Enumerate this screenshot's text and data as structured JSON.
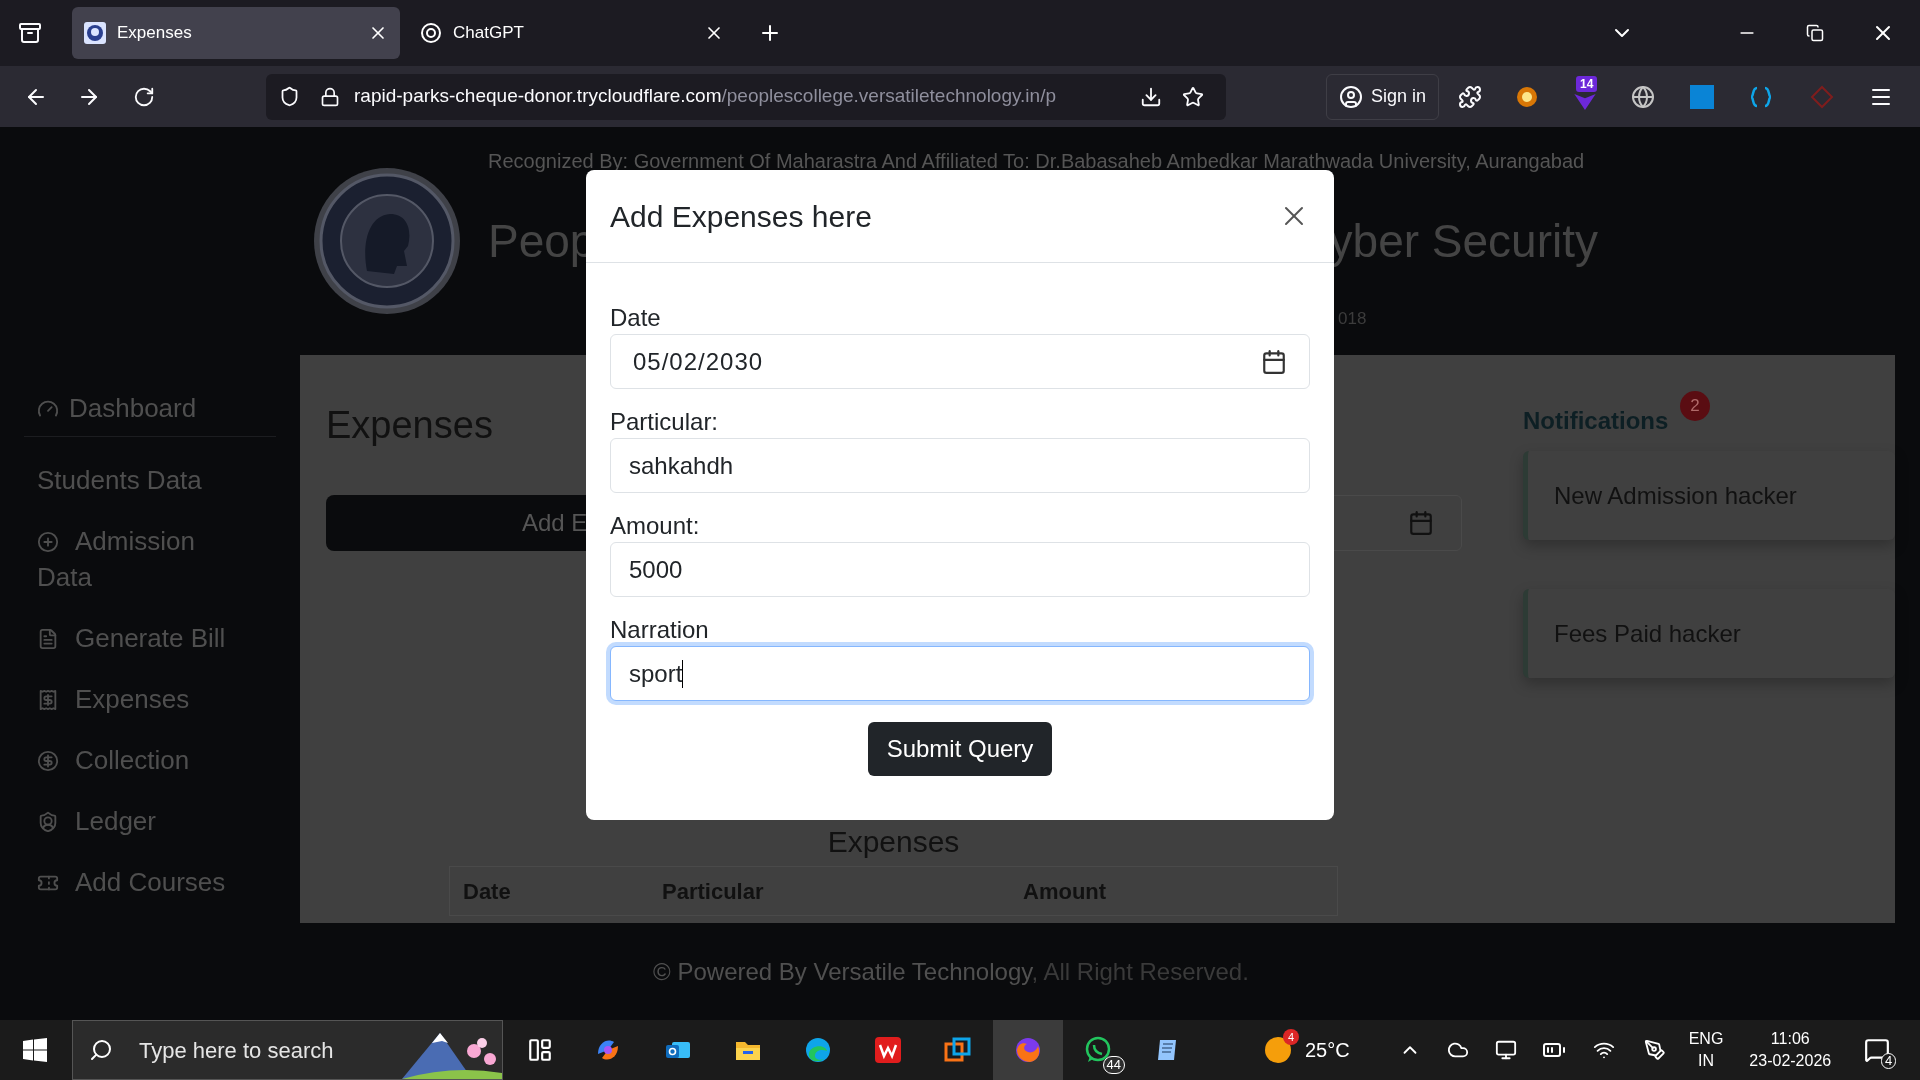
{
  "browser": {
    "tabs": [
      {
        "title": "Expenses",
        "selected": true
      },
      {
        "title": "ChatGPT",
        "selected": false
      }
    ],
    "url_host": "rapid-parks-cheque-donor.trycloudflare.com",
    "url_path": "/peoplescollege.versatiletechnology.in/p",
    "sign_in": "Sign in",
    "extension_badge": "14"
  },
  "header": {
    "recognition": "Recognized By: Government Of Maharastra And Affiliated To: Dr.Babasaheb Ambedkar Marathwada University, Aurangabad",
    "title_left": "Peop",
    "title_right": "yber Security",
    "subline_fragment": "018"
  },
  "sidebar": {
    "items": [
      {
        "label": "Dashboard",
        "kind": "link"
      },
      {
        "label": "Students Data",
        "kind": "section"
      },
      {
        "label": "Admission Data",
        "kind": "link"
      },
      {
        "label": "Generate Bill",
        "kind": "link"
      },
      {
        "label": "Expenses",
        "kind": "link"
      },
      {
        "label": "Collection",
        "kind": "link"
      },
      {
        "label": "Ledger",
        "kind": "link"
      },
      {
        "label": "Add Courses",
        "kind": "link"
      }
    ]
  },
  "page": {
    "title": "Expenses",
    "add_button": "Add E",
    "table_title": "Expenses",
    "table": {
      "columns": [
        "Date",
        "Particular",
        "Amount"
      ]
    }
  },
  "notifications": {
    "title": "Notifications",
    "count": "2",
    "items": [
      "New Admission hacker",
      "Fees Paid hacker"
    ]
  },
  "modal": {
    "title": "Add Expenses here",
    "fields": [
      {
        "label": "Date",
        "value": "05/02/2030",
        "kind": "date",
        "focused": false
      },
      {
        "label": "Particular:",
        "value": "sahkahdh",
        "kind": "text",
        "focused": false
      },
      {
        "label": "Amount:",
        "value": "5000",
        "kind": "text",
        "focused": false
      },
      {
        "label": "Narration",
        "value": "sport",
        "kind": "text",
        "focused": true
      }
    ],
    "submit": "Submit Query"
  },
  "footer": {
    "link": "© Powered By Versatile Technology",
    "rest": ", All Right Reserved."
  },
  "taskbar": {
    "search_placeholder": "Type here to search",
    "apps": [
      {
        "selected": false
      },
      {
        "selected": false
      },
      {
        "selected": false
      },
      {
        "selected": false
      },
      {
        "selected": false
      },
      {
        "selected": false
      },
      {
        "selected": true
      },
      {
        "selected": false,
        "badge": "44"
      },
      {
        "selected": false
      }
    ],
    "weather_badge": "4",
    "temperature": "25°C",
    "language": "ENG",
    "region": "IN",
    "time": "11:06",
    "date": "23-02-2026",
    "notification_count": "4"
  }
}
